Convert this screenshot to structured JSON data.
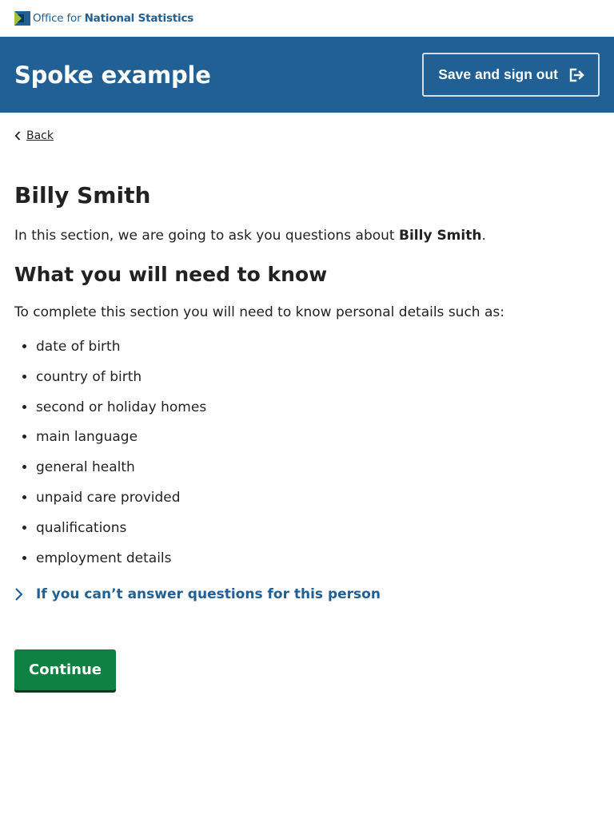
{
  "brand": {
    "prefix": "Office for ",
    "name": "National Statistics",
    "colors": {
      "primary": "#206095",
      "accent": "#a8bd3a",
      "dark": "#003c57"
    }
  },
  "header": {
    "title": "Spoke example",
    "signout_label": "Save and sign out",
    "signout_icon": "exit-icon"
  },
  "nav": {
    "back_label": "Back",
    "back_icon": "chevron-left-icon"
  },
  "content": {
    "heading": "Billy Smith",
    "intro_before": "In this section, we are going to ask you questions about ",
    "intro_name": "Billy Smith",
    "intro_after": ".",
    "subheading": "What you will need to know",
    "need_text": "To complete this section you will need to know personal details such as:",
    "items": [
      "date of birth",
      "country of birth",
      "second or holiday homes",
      "main language",
      "general health",
      "unpaid care provided",
      "qualifications",
      "employment details"
    ],
    "details_label": "If you can’t answer questions for this person",
    "details_icon": "chevron-right-icon"
  },
  "actions": {
    "continue_label": "Continue",
    "continue_color": "#0f8243"
  }
}
